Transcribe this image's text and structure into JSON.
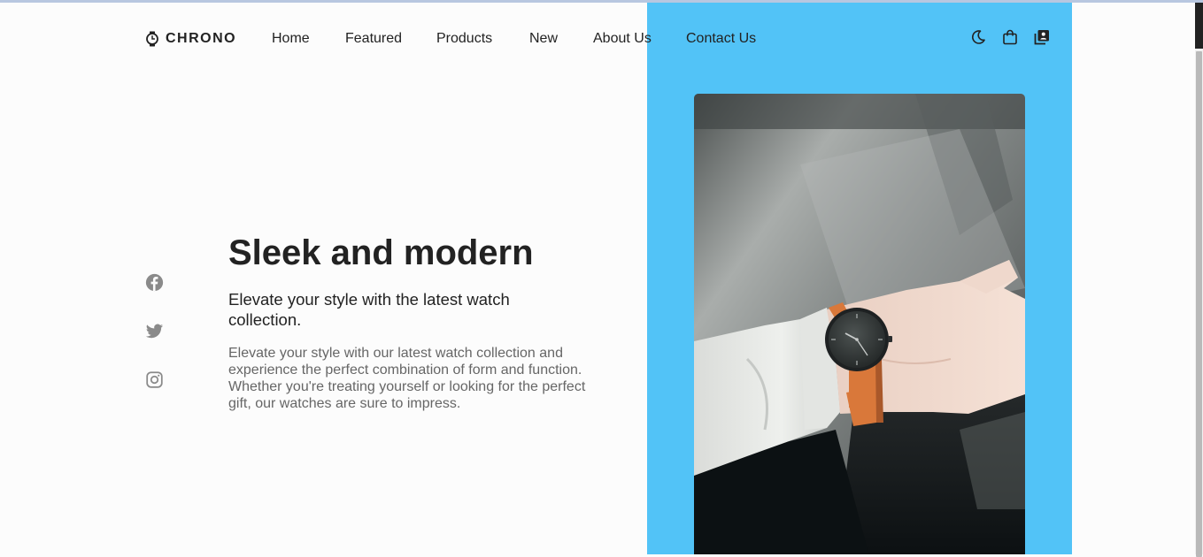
{
  "brand": {
    "name": "CHRONO",
    "icon": "watch-icon"
  },
  "nav": {
    "items": [
      {
        "label": "Home"
      },
      {
        "label": "Featured"
      },
      {
        "label": "Products"
      },
      {
        "label": "New"
      },
      {
        "label": "About Us"
      },
      {
        "label": "Contact Us"
      }
    ]
  },
  "actions": {
    "theme_icon": "moon-icon",
    "cart_icon": "shopping-bag-icon",
    "account_icon": "user-box-icon"
  },
  "hero": {
    "title": "Sleek and modern",
    "subtitle": "Elevate your style with the latest watch collection.",
    "description": "Elevate your style with our latest watch collection and experience the perfect combination of form and function. Whether you're treating yourself or looking for the perfect gift, our watches are sure to impress."
  },
  "social": {
    "icons": [
      "facebook-icon",
      "twitter-icon",
      "instagram-icon"
    ]
  },
  "colors": {
    "accent": "#52c3f7",
    "text": "#222222",
    "muted": "#666666",
    "icon": "#8a8a8a",
    "strap": "#d9783a"
  }
}
